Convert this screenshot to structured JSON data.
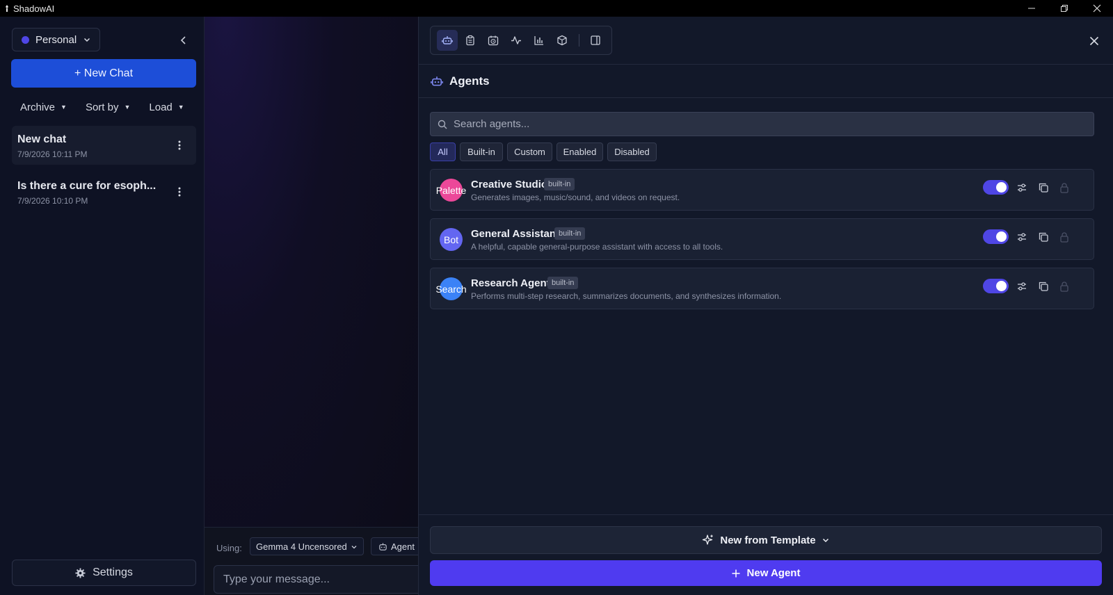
{
  "window": {
    "title": "ShadowAI",
    "controls": [
      "minimize-icon",
      "restore-icon",
      "close-icon"
    ]
  },
  "sidebar": {
    "workspace": {
      "label": "Personal",
      "dot_color": "#4f46e5"
    },
    "new_chat_label": "+ New Chat",
    "filters": [
      {
        "label": "Archive"
      },
      {
        "label": "Sort by"
      },
      {
        "label": "Load"
      }
    ],
    "chats": [
      {
        "title": "New chat",
        "date": "7/9/2026 10:11 PM",
        "active": true
      },
      {
        "title": "Is there a cure for esoph...",
        "date": "7/9/2026 10:10 PM",
        "active": false
      }
    ],
    "settings_label": "Settings"
  },
  "composer": {
    "using_label": "Using:",
    "model": "Gemma 4 Uncensored",
    "agent_label": "Agent",
    "placeholder": "Type your message..."
  },
  "panel": {
    "toolbar_icons": [
      "bot-icon",
      "clipboard-icon",
      "calendar-clock-icon",
      "activity-icon",
      "bar-chart-icon",
      "package-icon",
      "panel-right-icon"
    ],
    "title": "Agents",
    "search_placeholder": "Search agents...",
    "tabs": [
      {
        "label": "All",
        "active": true
      },
      {
        "label": "Built-in",
        "active": false
      },
      {
        "label": "Custom",
        "active": false
      },
      {
        "label": "Enabled",
        "active": false
      },
      {
        "label": "Disabled",
        "active": false
      }
    ],
    "agents": [
      {
        "avatar": "Palette",
        "avatar_color": "#ec4899",
        "name": "Creative Studio",
        "badge": "built-in",
        "description": "Generates images, music/sound, and videos on request.",
        "enabled": true
      },
      {
        "avatar": "Bot",
        "avatar_color": "#6366f1",
        "name": "General Assistant",
        "badge": "built-in",
        "description": "A helpful, capable general-purpose assistant with access to all tools.",
        "enabled": true
      },
      {
        "avatar": "Search",
        "avatar_color": "#3b82f6",
        "name": "Research Agent",
        "badge": "built-in",
        "description": "Performs multi-step research, summarizes documents, and synthesizes information.",
        "enabled": true
      }
    ],
    "template_label": "New from Template",
    "new_agent_label": "New Agent"
  },
  "colors": {
    "accent": "#4f46e5",
    "new_chat": "#1d4ed8",
    "new_agent": "#4f3bf0"
  }
}
